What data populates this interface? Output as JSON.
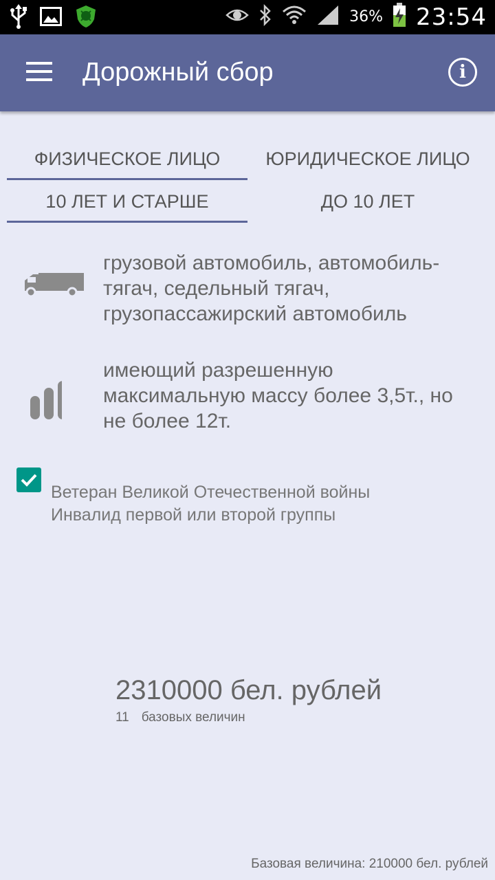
{
  "status_bar": {
    "icons_left": [
      "usb-icon",
      "image-icon",
      "shield-icon"
    ],
    "icons_right": [
      "eye-icon",
      "bluetooth-icon",
      "wifi-icon",
      "signal-icon",
      "battery-charging-icon"
    ],
    "battery_percent": "36%",
    "time": "23:54"
  },
  "app_bar": {
    "title": "Дорожный сбор",
    "menu_icon": "menu-icon",
    "info_icon": "info-icon",
    "info_glyph": "i",
    "color": "#5C6699"
  },
  "owner_tabs": [
    {
      "label": "ФИЗИЧЕСКОЕ ЛИЦО",
      "active": true
    },
    {
      "label": "ЮРИДИЧЕСКОЕ ЛИЦО",
      "active": false
    }
  ],
  "age_tabs": [
    {
      "label": "10 ЛЕТ И СТАРШЕ",
      "active": true
    },
    {
      "label": "ДО 10 ЛЕТ",
      "active": false
    }
  ],
  "vehicle": {
    "icon": "truck-icon",
    "lines": [
      "грузовой автомобиль, автомобиль-",
      "тягач, седельный тягач,",
      "грузопассажирский автомобиль"
    ]
  },
  "mass": {
    "icon": "bars-icon",
    "lines": [
      "имеющий разрешенную",
      "максимальную массу более 3,5т., но",
      "не более 12т."
    ]
  },
  "benefit": {
    "checked": true,
    "lines": [
      "Ветеран Великой Отечественной войны",
      "Инвалид первой или второй группы"
    ],
    "color": "#009688"
  },
  "result": {
    "amount": "2310000 бел. рублей",
    "base_count": "11",
    "base_label": "базовых величин"
  },
  "footer": "Базовая величина: 210000 бел. рублей"
}
